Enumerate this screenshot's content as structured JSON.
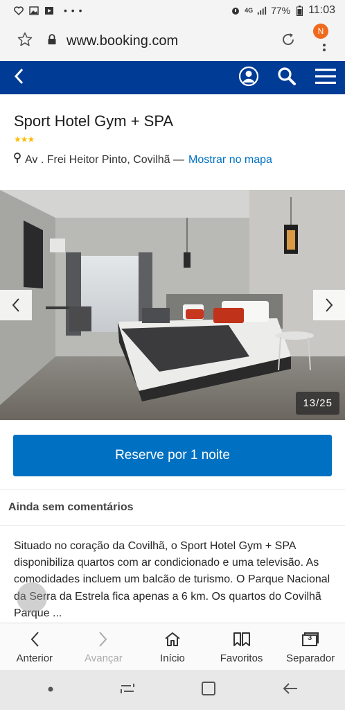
{
  "status_bar": {
    "battery": "77%",
    "time": "11:03",
    "network": "4G"
  },
  "url_bar": {
    "url": "www.booking.com",
    "profile_badge": "N"
  },
  "hotel": {
    "name": "Sport Hotel Gym + SPA",
    "stars": "★★★",
    "address": "Av . Frei Heitor Pinto, Covilhã —",
    "map_link": "Mostrar no mapa"
  },
  "gallery": {
    "counter": "13/25"
  },
  "reserve_label": "Reserve por 1 noite",
  "reviews_label": "Ainda sem comentários",
  "description": "Situado no coração da Covilhã, o Sport Hotel Gym + SPA disponibiliza quartos com ar condicionado e uma televisão. As comodidades incluem um balcão de turismo. O Parque Nacional da Serra da Estrela fica apenas a 6 km. Os quartos do Covilhã Parque ...",
  "browser_nav": [
    {
      "label": "Anterior",
      "icon": "chevron-left-icon"
    },
    {
      "label": "Avançar",
      "icon": "chevron-right-icon"
    },
    {
      "label": "Início",
      "icon": "home-icon"
    },
    {
      "label": "Favoritos",
      "icon": "bookmarks-icon"
    },
    {
      "label": "Separador",
      "icon": "tabs-icon",
      "tab_count": "3"
    }
  ],
  "colors": {
    "header": "#003b95",
    "accent": "#0071c2",
    "stars": "#febb02",
    "badge": "#f06a1e"
  }
}
